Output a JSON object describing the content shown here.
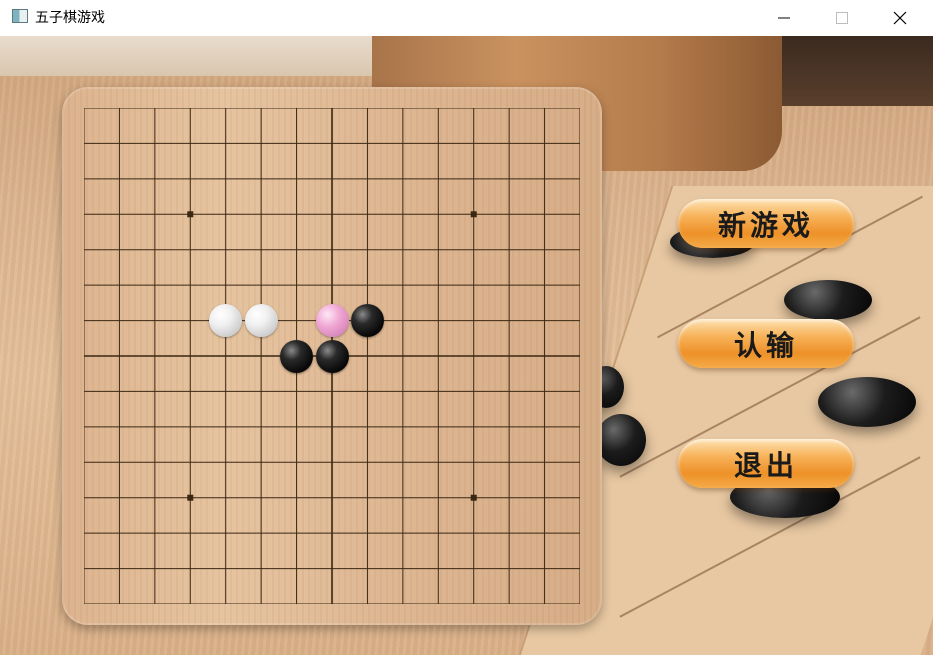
{
  "window": {
    "title": "五子棋游戏",
    "minimize_icon": "minimize-icon",
    "maximize_icon": "maximize-icon",
    "close_icon": "close-icon"
  },
  "board": {
    "size": 15,
    "star_points": [
      [
        3,
        3
      ],
      [
        3,
        11
      ],
      [
        11,
        3
      ],
      [
        11,
        11
      ]
    ],
    "stones": [
      {
        "color": "white",
        "col": 4,
        "row": 6
      },
      {
        "color": "white",
        "col": 5,
        "row": 6
      },
      {
        "color": "pink",
        "col": 7,
        "row": 6
      },
      {
        "color": "black",
        "col": 8,
        "row": 6
      },
      {
        "color": "black",
        "col": 6,
        "row": 7
      },
      {
        "color": "black",
        "col": 7,
        "row": 7
      }
    ]
  },
  "menu": {
    "new_game": "新游戏",
    "surrender": "认输",
    "exit": "退出"
  },
  "colors": {
    "button_orange": "#f29a33",
    "board_wood": "#e0bb95",
    "grid_line": "#3b2712"
  }
}
